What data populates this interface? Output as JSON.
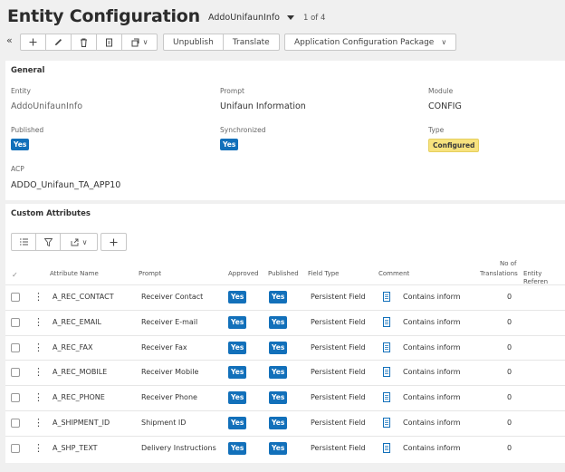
{
  "header": {
    "title": "Entity Configuration",
    "record_name": "AddoUnifaunInfo",
    "record_count": "1 of 4"
  },
  "toolbar": {
    "unpublish_label": "Unpublish",
    "translate_label": "Translate",
    "acp_label": "Application Configuration Package"
  },
  "general": {
    "title": "General",
    "entity_label": "Entity",
    "entity_value": "AddoUnifaunInfo",
    "prompt_label": "Prompt",
    "prompt_value": "Unifaun Information",
    "module_label": "Module",
    "module_value": "CONFIG",
    "published_label": "Published",
    "published_value": "Yes",
    "synchronized_label": "Synchronized",
    "synchronized_value": "Yes",
    "type_label": "Type",
    "type_value": "Configured",
    "acp_label": "ACP",
    "acp_value": "ADDO_Unifaun_TA_APP10"
  },
  "custom_attributes": {
    "title": "Custom Attributes",
    "columns": {
      "attribute_name": "Attribute Name",
      "prompt": "Prompt",
      "approved": "Approved",
      "published": "Published",
      "field_type": "Field Type",
      "comment": "Comment",
      "no_of": "No of",
      "translations": "Translations",
      "entity_reference": "Entity Referen"
    },
    "rows": [
      {
        "name": "A_REC_CONTACT",
        "prompt": "Receiver Contact",
        "approved": "Yes",
        "published": "Yes",
        "field_type": "Persistent Field",
        "comment": "Contains inform",
        "translations": "0"
      },
      {
        "name": "A_REC_EMAIL",
        "prompt": "Receiver E-mail",
        "approved": "Yes",
        "published": "Yes",
        "field_type": "Persistent Field",
        "comment": "Contains inform",
        "translations": "0"
      },
      {
        "name": "A_REC_FAX",
        "prompt": "Receiver Fax",
        "approved": "Yes",
        "published": "Yes",
        "field_type": "Persistent Field",
        "comment": "Contains inform",
        "translations": "0"
      },
      {
        "name": "A_REC_MOBILE",
        "prompt": "Receiver Mobile",
        "approved": "Yes",
        "published": "Yes",
        "field_type": "Persistent Field",
        "comment": "Contains inform",
        "translations": "0"
      },
      {
        "name": "A_REC_PHONE",
        "prompt": "Receiver Phone",
        "approved": "Yes",
        "published": "Yes",
        "field_type": "Persistent Field",
        "comment": "Contains inform",
        "translations": "0"
      },
      {
        "name": "A_SHIPMENT_ID",
        "prompt": "Shipment ID",
        "approved": "Yes",
        "published": "Yes",
        "field_type": "Persistent Field",
        "comment": "Contains inform",
        "translations": "0"
      },
      {
        "name": "A_SHP_TEXT",
        "prompt": "Delivery Instructions",
        "approved": "Yes",
        "published": "Yes",
        "field_type": "Persistent Field",
        "comment": "Contains inform",
        "translations": "0"
      }
    ]
  },
  "colors": {
    "badge_blue": "#1270ba",
    "badge_yellow": "#f7e27e",
    "link_blue": "#1d6fc6"
  }
}
